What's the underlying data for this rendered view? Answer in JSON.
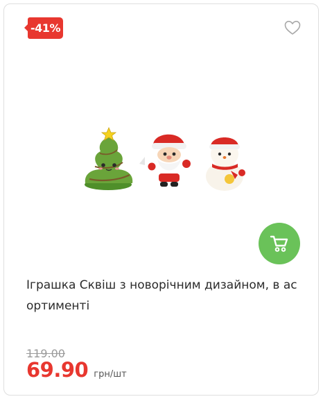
{
  "badge": {
    "discount": "-41%",
    "color": "#e8372f"
  },
  "favorite": {
    "icon": "heart-outline-icon"
  },
  "product": {
    "title": "Іграшка Сквіш з новорічним дизайном, в ас ортименті",
    "image_icon": "product-image"
  },
  "cart": {
    "icon": "cart-icon",
    "color": "#6ac259"
  },
  "pricing": {
    "old_price": "119.00",
    "price": "69.90",
    "unit": "грн/шт",
    "price_color": "#e8372f"
  }
}
